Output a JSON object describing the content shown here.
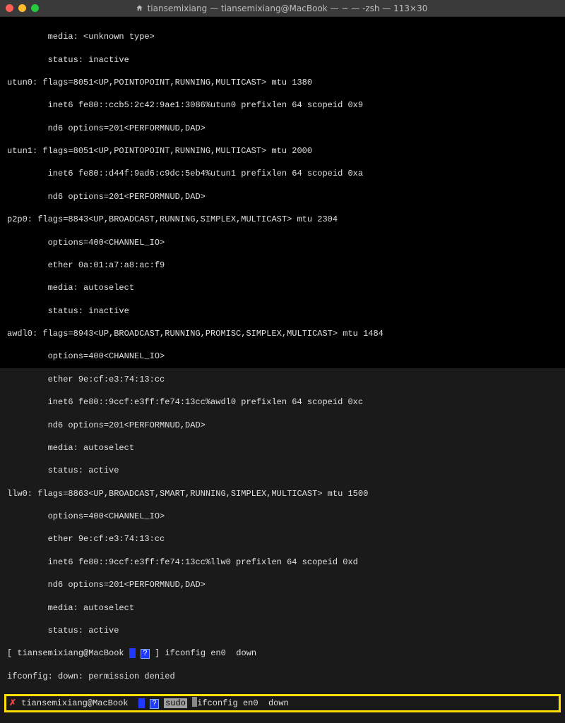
{
  "window": {
    "title": "tiansemixiang — tiansemixiang@MacBook — ~ — -zsh — 113×30"
  },
  "lines": {
    "l0": "        media: <unknown type>",
    "l1": "        status: inactive",
    "l2": "utun0: flags=8051<UP,POINTOPOINT,RUNNING,MULTICAST> mtu 1380",
    "l3": "        inet6 fe80::ccb5:2c42:9ae1:3086%utun0 prefixlen 64 scopeid 0x9",
    "l4": "        nd6 options=201<PERFORMNUD,DAD>",
    "l5": "utun1: flags=8051<UP,POINTOPOINT,RUNNING,MULTICAST> mtu 2000",
    "l6": "        inet6 fe80::d44f:9ad6:c9dc:5eb4%utun1 prefixlen 64 scopeid 0xa",
    "l7": "        nd6 options=201<PERFORMNUD,DAD>",
    "l8": "p2p0: flags=8843<UP,BROADCAST,RUNNING,SIMPLEX,MULTICAST> mtu 2304",
    "l9": "        options=400<CHANNEL_IO>",
    "l10": "        ether 0a:01:a7:a8:ac:f9",
    "l11": "        media: autoselect",
    "l12": "        status: inactive",
    "l13": "awdl0: flags=8943<UP,BROADCAST,RUNNING,PROMISC,SIMPLEX,MULTICAST> mtu 1484",
    "l14": "        options=400<CHANNEL_IO>",
    "l15": "        ether 9e:cf:e3:74:13:cc",
    "l16": "        inet6 fe80::9ccf:e3ff:fe74:13cc%awdl0 prefixlen 64 scopeid 0xc",
    "l17": "        nd6 options=201<PERFORMNUD,DAD>",
    "l18": "        media: autoselect",
    "l19": "        status: active",
    "l20": "llw0: flags=8863<UP,BROADCAST,SMART,RUNNING,SIMPLEX,MULTICAST> mtu 1500",
    "l21": "        options=400<CHANNEL_IO>",
    "l22": "        ether 9e:cf:e3:74:13:cc",
    "l23": "        inet6 fe80::9ccf:e3ff:fe74:13cc%llw0 prefixlen 64 scopeid 0xd",
    "l24": "        nd6 options=201<PERFORMNUD,DAD>",
    "l25": "        media: autoselect",
    "l26": "        status: active"
  },
  "prompt1": {
    "bracket_open": "[ ",
    "user": "tiansemixiang@MacBook",
    "seg_q": "?",
    "seg_close": "] ",
    "cmd": "ifconfig en0  down"
  },
  "err_line": "ifconfig: down: permission denied",
  "prompt2": {
    "x": "✗",
    "user": "tiansemixiang@MacBook",
    "seg_q": "?",
    "sudo": "sudo",
    "cmd": "ifconfig en0  down"
  }
}
